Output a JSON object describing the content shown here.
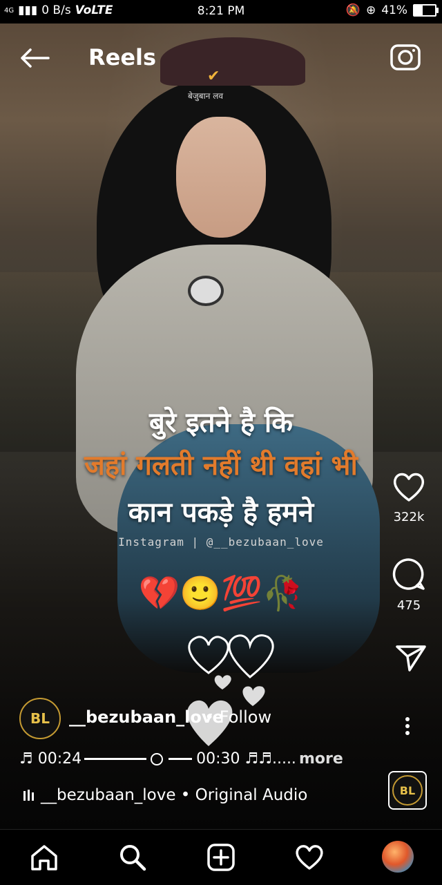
{
  "status_bar": {
    "network_type": "4G",
    "data_speed": "0 B/s",
    "volte": "VoLTE",
    "time": "8:21 PM",
    "battery_percent": "41%",
    "battery_level": 0.41
  },
  "header": {
    "title": "Reels",
    "back_icon": "arrow-left-icon",
    "camera_icon": "camera-icon"
  },
  "video": {
    "watermark_text": "बेजुबान लव",
    "overlay_lines": [
      "बुरे इतने है कि",
      "जहां गलती नहीं थी वहां भी",
      "कान पकड़े है हमने"
    ],
    "instagram_handle": "Instagram | @__bezubaan_love",
    "emojis": "💔🙂💯🥀"
  },
  "actions": {
    "likes": "322k",
    "comments": "475",
    "like_icon": "heart-icon",
    "comment_icon": "comment-icon",
    "share_icon": "send-icon",
    "more_icon": "more-vertical-icon"
  },
  "reel_info": {
    "avatar_text": "BL",
    "username": "__bezubaan_love",
    "follow_text": "• Follow",
    "caption_start": "♬ 00:24",
    "caption_end": "00:30 ♬♬.....",
    "caption_more": "more",
    "audio_text": "__bezubaan_love • Original Audio"
  },
  "bottom_nav": {
    "items": [
      "home-icon",
      "search-icon",
      "add-post-icon",
      "activity-heart-icon",
      "profile-avatar"
    ]
  }
}
